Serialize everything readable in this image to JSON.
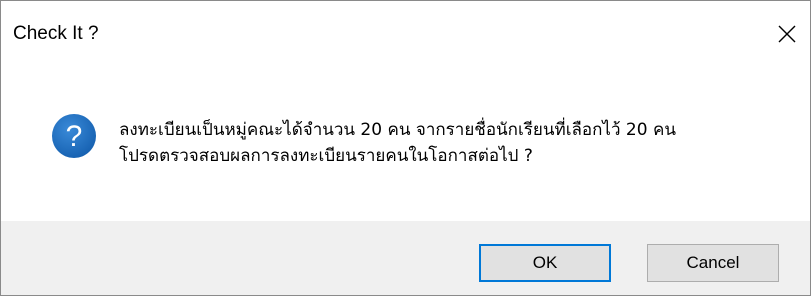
{
  "window": {
    "title": "Check It ?",
    "close_icon": "close-icon"
  },
  "dialog": {
    "icon": "question-icon",
    "icon_color": "#1e6fc0",
    "message_line1": "ลงทะเบียนเป็นหมู่คณะได้จำนวน 20 คน  จากรายชื่อนักเรียนที่เลือกไว้ 20 คน",
    "message_line2": "โปรดตรวจสอบผลการลงทะเบียนรายคนในโอกาสต่อไป ?"
  },
  "buttons": {
    "ok_label": "OK",
    "cancel_label": "Cancel",
    "default_border_color": "#0078d7"
  }
}
